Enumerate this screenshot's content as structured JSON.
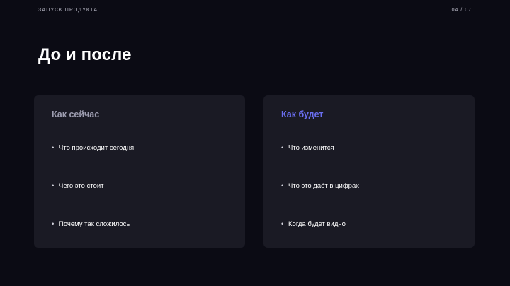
{
  "header": {
    "eyebrow": "ЗАПУСК ПРОДУКТА",
    "pager": "04 / 07"
  },
  "slide": {
    "title": "До и после"
  },
  "columns": [
    {
      "title": "Как сейчас",
      "items": [
        "Что происходит сегодня",
        "Чего это стоит",
        "Почему так сложилось"
      ]
    },
    {
      "title": "Как будет",
      "items": [
        "Что изменится",
        "Что это даёт в цифрах",
        "Когда будет видно"
      ]
    }
  ],
  "bullet_char": "•",
  "colors": {
    "background": "#0b0b14",
    "card": "#1a1a24",
    "muted_title": "#9d9db0",
    "accent": "#6a6ef0"
  }
}
